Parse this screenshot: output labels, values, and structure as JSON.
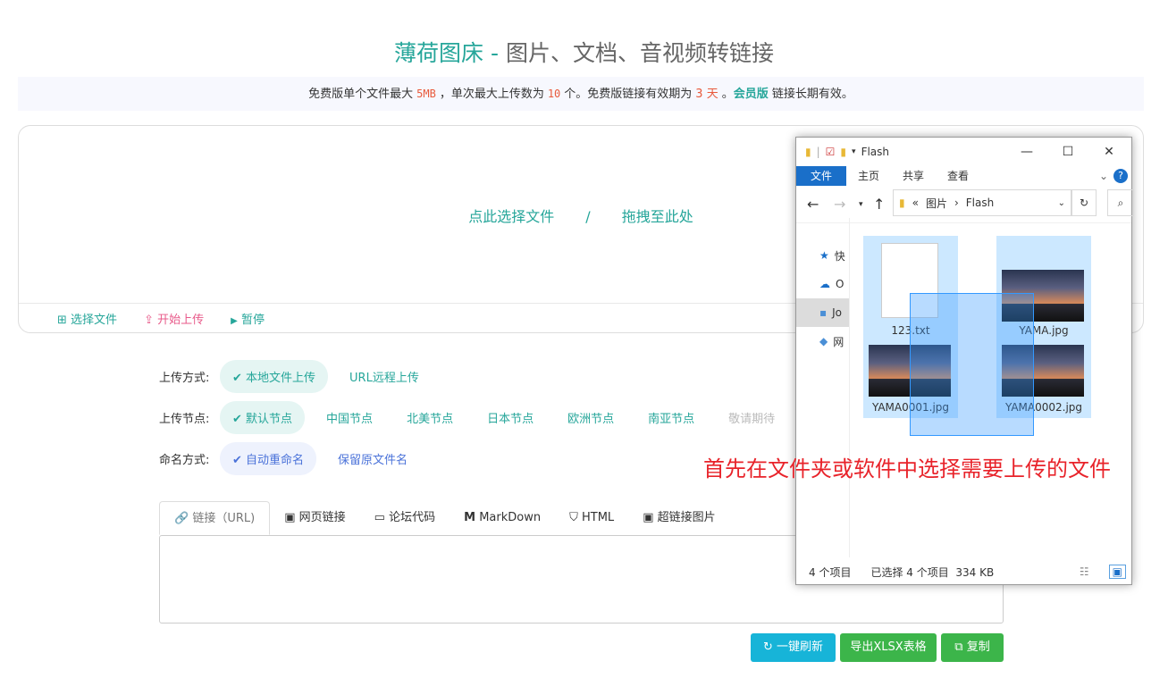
{
  "header": {
    "brand": "薄荷图床",
    "sep": " - ",
    "subtitle": "图片、文档、音视频转链接"
  },
  "notice": {
    "t1": "免费版单个文件最大",
    "max_size": "5MB",
    "t2": "，单次最大上传数为",
    "max_count": "10",
    "t3": "个。免费版链接有效期为",
    "days": "3 天",
    "t4": "。",
    "vip": "会员版",
    "t5": "链接长期有效。"
  },
  "dropzone": {
    "select": "点此选择文件",
    "divider": "/",
    "drag": "拖拽至此处",
    "btn_select": "选择文件",
    "btn_start": "开始上传",
    "btn_pause": "暂停"
  },
  "options": {
    "upload_mode": {
      "label": "上传方式:",
      "items": [
        "本地文件上传",
        "URL远程上传"
      ]
    },
    "node": {
      "label": "上传节点:",
      "items": [
        "默认节点",
        "中国节点",
        "北美节点",
        "日本节点",
        "欧洲节点",
        "南亚节点",
        "敬请期待"
      ]
    },
    "naming": {
      "label": "命名方式:",
      "items": [
        "自动重命名",
        "保留原文件名"
      ]
    }
  },
  "tabs": [
    "链接（URL)",
    "网页链接",
    "论坛代码",
    "MarkDown",
    "HTML",
    "超链接图片"
  ],
  "buttons": {
    "refresh": "一键刷新",
    "export": "导出XLSX表格",
    "copy": "复制"
  },
  "explorer": {
    "title": "Flash",
    "ribbon": [
      "文件",
      "主页",
      "共享",
      "查看"
    ],
    "path_prefix": "«",
    "path": [
      "图片",
      "Flash"
    ],
    "nav": [
      "快",
      "O",
      "Jo",
      "网"
    ],
    "files": [
      "123.txt",
      "YAMA.jpg",
      "YAMA0001.jpg",
      "YAMA0002.jpg"
    ],
    "status_count": "4 个项目",
    "status_selected": "已选择 4 个项目",
    "status_size": "334 KB"
  },
  "annotation": "首先在文件夹或软件中选择需要上传的文件"
}
